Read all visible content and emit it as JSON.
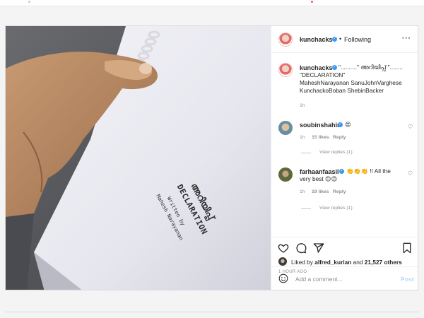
{
  "post": {
    "author": "kunchacks",
    "follow_status": "Following",
    "caption_lines": [
      "\"..........\" അറിയിപ്പ് \"........",
      "\"DECLARATION\"",
      "MaheshNarayanan SanuJohnVarghese",
      "KunchackoBoban ShebinBacker"
    ],
    "caption_age": "1h",
    "image_text": {
      "malayalam_title": "അറിയിപ്പ്",
      "english_title": "DECLARATION",
      "written_by": "Written by",
      "writer": "Mahesh Narayanan"
    }
  },
  "comments": [
    {
      "user": "soubinshahir",
      "text": "😍",
      "age": "1h",
      "likes": "15 likes",
      "reply": "Reply",
      "view_replies": "View replies (1)"
    },
    {
      "user": "farhaanfaasil",
      "text_line1": "👏👏👏 !! All the",
      "text_line2": "very best 😊😊",
      "age": "1h",
      "likes": "19 likes",
      "reply": "Reply",
      "view_replies": "View replies (1)"
    }
  ],
  "likes_summary": {
    "prefix": "Liked by ",
    "user": "alfred_kurian",
    "middle": " and ",
    "count": "21,527 others"
  },
  "timestamp": "1 HOUR AGO",
  "add_comment": {
    "placeholder": "Add a comment...",
    "post_label": "Post"
  },
  "colors": {
    "verified": "#3897f0",
    "muted_text": "#8e8e8e",
    "post_disabled": "#b3dbff"
  },
  "icons": {
    "header": "more-options-icon",
    "actions": [
      "like-heart-icon",
      "comment-icon",
      "share-icon",
      "save-bookmark-icon"
    ],
    "comment_like": "heart-icon",
    "add_comment": "emoji-icon"
  }
}
